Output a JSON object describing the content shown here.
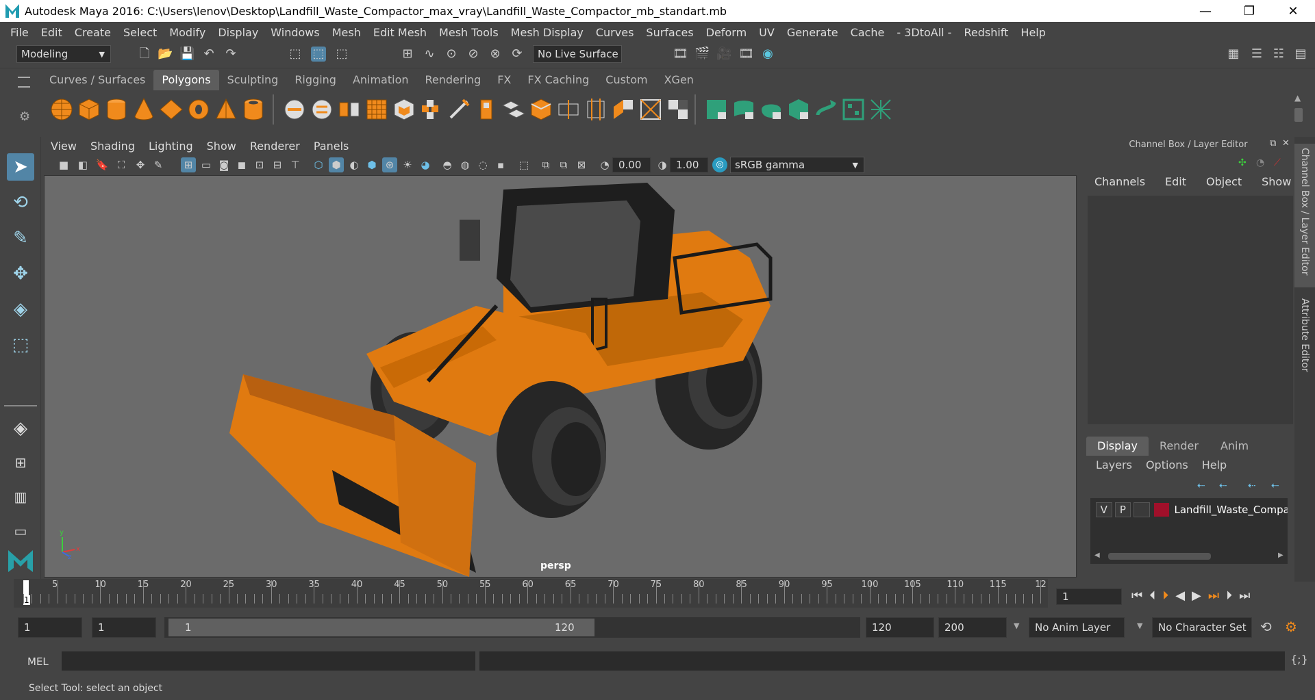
{
  "window": {
    "title": "Autodesk Maya 2016: C:\\Users\\lenov\\Desktop\\Landfill_Waste_Compactor_max_vray\\Landfill_Waste_Compactor_mb_standart.mb",
    "minimize": "—",
    "restore": "❐",
    "close": "✕"
  },
  "menubar": [
    "File",
    "Edit",
    "Create",
    "Select",
    "Modify",
    "Display",
    "Windows",
    "Mesh",
    "Edit Mesh",
    "Mesh Tools",
    "Mesh Display",
    "Curves",
    "Surfaces",
    "Deform",
    "UV",
    "Generate",
    "Cache",
    "- 3DtoAll -",
    "Redshift",
    "Help"
  ],
  "statusline": {
    "mode": "Modeling",
    "live_surface": "No Live Surface"
  },
  "shelf": {
    "tabs": [
      "Curves / Surfaces",
      "Polygons",
      "Sculpting",
      "Rigging",
      "Animation",
      "Rendering",
      "FX",
      "FX Caching",
      "Custom",
      "XGen"
    ],
    "selected": "Polygons"
  },
  "viewport": {
    "menu": [
      "View",
      "Shading",
      "Lighting",
      "Show",
      "Renderer",
      "Panels"
    ],
    "exposure": "0.00",
    "gamma": "1.00",
    "colorspace": "sRGB gamma",
    "camera_label": "persp",
    "axis_y": "y",
    "axis_x": "x",
    "axis_z": "z"
  },
  "channelbox": {
    "header": "Channel Box / Layer Editor",
    "menu": [
      "Channels",
      "Edit",
      "Object",
      "Show"
    ],
    "layer_tabs": [
      "Display",
      "Render",
      "Anim"
    ],
    "layer_tab_selected": "Display",
    "layer_menu": [
      "Layers",
      "Options",
      "Help"
    ],
    "layer": {
      "v": "V",
      "p": "P",
      "name": "Landfill_Waste_Compa",
      "color": "#a0102a"
    }
  },
  "side_tabs": {
    "channel": "Channel Box / Layer Editor",
    "attribute": "Attribute Editor"
  },
  "timeslider": {
    "ticks": [
      "5",
      "10",
      "15",
      "20",
      "25",
      "30",
      "35",
      "40",
      "45",
      "50",
      "55",
      "60",
      "65",
      "70",
      "75",
      "80",
      "85",
      "90",
      "95",
      "100",
      "105",
      "110",
      "115",
      "12"
    ],
    "current_marker": "1",
    "current_frame": "1"
  },
  "range": {
    "start": "1",
    "start2": "1",
    "slider_start": "1",
    "slider_end": "120",
    "end": "120",
    "end2": "200",
    "anim_layer": "No Anim Layer",
    "char_set": "No Character Set"
  },
  "cmdline": {
    "label": "MEL"
  },
  "helpline": {
    "text": "Select Tool: select an object"
  },
  "colors": {
    "accent": "#5285a6",
    "model_orange": "#e07a10",
    "viewport_bg": "#6b6b6b"
  }
}
